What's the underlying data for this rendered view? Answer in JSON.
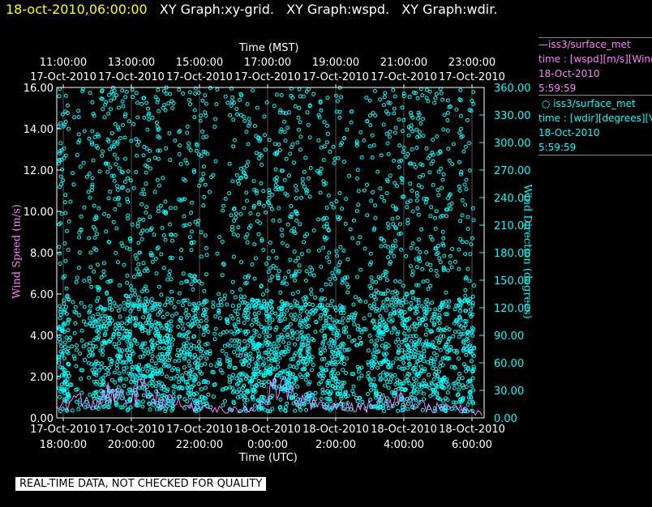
{
  "header": {
    "timestamp": "18-oct-2010,06:00:00",
    "graphs": [
      "XY Graph:xy-grid.",
      "XY Graph:wspd.",
      "XY Graph:wdir."
    ]
  },
  "axes": {
    "top_title": "Time (MST)",
    "bottom_title": "Time (UTC)",
    "left_title": "Wind Speed (m/s)",
    "right_title": "Wind Direction (degrees)",
    "top_ticks": [
      {
        "time": "11:00:00",
        "date": "17-Oct-2010"
      },
      {
        "time": "13:00:00",
        "date": "17-Oct-2010"
      },
      {
        "time": "15:00:00",
        "date": "17-Oct-2010"
      },
      {
        "time": "17:00:00",
        "date": "17-Oct-2010"
      },
      {
        "time": "19:00:00",
        "date": "17-Oct-2010"
      },
      {
        "time": "21:00:00",
        "date": "17-Oct-2010"
      },
      {
        "time": "23:00:00",
        "date": "17-Oct-2010"
      }
    ],
    "bottom_ticks": [
      {
        "date": "17-Oct-2010",
        "time": "18:00:00"
      },
      {
        "date": "17-Oct-2010",
        "time": "20:00:00"
      },
      {
        "date": "17-Oct-2010",
        "time": "22:00:00"
      },
      {
        "date": "18-Oct-2010",
        "time": "0:00:00"
      },
      {
        "date": "18-Oct-2010",
        "time": "2:00:00"
      },
      {
        "date": "18-Oct-2010",
        "time": "4:00:00"
      },
      {
        "date": "18-Oct-2010",
        "time": "6:00:00"
      }
    ],
    "left_ticks": [
      "0.00",
      "2.00",
      "4.00",
      "6.00",
      "8.00",
      "10.00",
      "12.00",
      "14.00",
      "16.00"
    ],
    "right_ticks": [
      "0.00",
      "30.00",
      "60.00",
      "90.00",
      "120.00",
      "150.00",
      "180.00",
      "210.00",
      "240.00",
      "270.00",
      "300.00",
      "330.00",
      "360.00"
    ]
  },
  "legend": {
    "wspd": {
      "name": "iss3/surface_met",
      "line2": "time : [wspd][m/s][Wind",
      "line3": "18-Oct-2010",
      "line4": "5:59:59",
      "color": "#ff80ff"
    },
    "wdir": {
      "name": "iss3/surface_met",
      "line2": "time : [wdir][degrees][V",
      "line3": "18-Oct-2010",
      "line4": "5:59:59",
      "color": "#00ffff"
    }
  },
  "disclaimer": "REAL-TIME DATA, NOT CHECKED FOR QUALITY",
  "chart_data": {
    "type": "scatter",
    "x_axis_bottom": "Time (UTC)",
    "x_axis_top": "Time (MST)",
    "xlim_utc": [
      "17-Oct-2010 17:30",
      "18-Oct-2010 06:00"
    ],
    "grid": false,
    "series": [
      {
        "name": "iss3/surface_met time : [wspd][m/s][Wind",
        "axis": "left",
        "style": "line",
        "color": "#ff80ff",
        "ylim": [
          0,
          16
        ],
        "ylabel": "Wind Speed (m/s)",
        "x_utc_hours": [
          17.5,
          18,
          18.5,
          19,
          19.5,
          20,
          20.5,
          21,
          21.5,
          22,
          22.5,
          23,
          23.5,
          24,
          24.5,
          25,
          25.5,
          26,
          26.5,
          27,
          27.5,
          28,
          28.5,
          29,
          29.5,
          30
        ],
        "values": [
          0.4,
          0.8,
          0.6,
          1.0,
          0.8,
          1.2,
          0.8,
          0.6,
          0.5,
          0.4,
          0.3,
          0.4,
          0.6,
          1.5,
          0.8,
          0.7,
          0.5,
          0.6,
          0.4,
          0.8,
          1.0,
          0.6,
          0.4,
          0.5,
          0.3,
          0.2
        ]
      },
      {
        "name": "iss3/surface_met time : [wdir][degrees][V",
        "axis": "right",
        "style": "points",
        "color": "#00ffff",
        "ylim": [
          0,
          360
        ],
        "ylabel": "Wind Direction (degrees)",
        "description_values": "dense scatter spanning 0–360 degrees throughout period"
      }
    ]
  }
}
